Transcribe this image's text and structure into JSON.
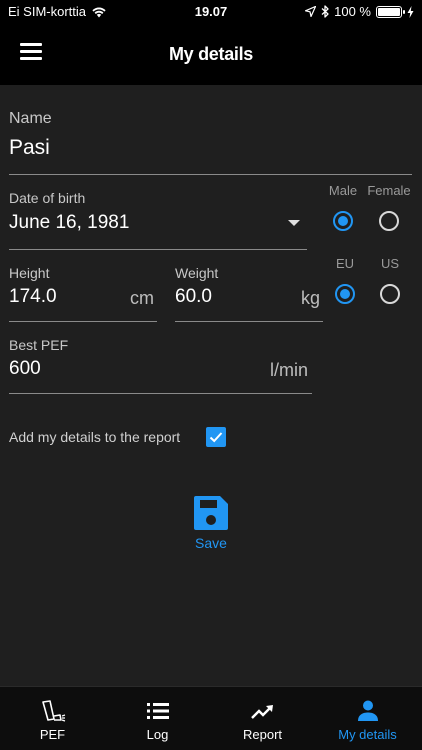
{
  "status_bar": {
    "carrier": "Ei SIM-korttia",
    "time": "19.07",
    "battery": "100 %",
    "battery_level": 1.0
  },
  "app_bar": {
    "title": "My details",
    "menu_icon": "hamburger-menu-icon"
  },
  "form": {
    "name": {
      "label": "Name",
      "value": "Pasi"
    },
    "date_of_birth": {
      "label": "Date of birth",
      "value": "June 16, 1981"
    },
    "gender": {
      "options": [
        "Male",
        "Female"
      ],
      "selected": "Male"
    },
    "height": {
      "label": "Height",
      "value": "174.0",
      "unit": "cm"
    },
    "weight": {
      "label": "Weight",
      "value": "60.0",
      "unit": "kg"
    },
    "units": {
      "options": [
        "EU",
        "US"
      ],
      "selected": "EU"
    },
    "best_pef": {
      "label": "Best PEF",
      "value": "600",
      "unit": "l/min"
    },
    "add_to_report": {
      "label": "Add my details to the report",
      "checked": true
    }
  },
  "save": {
    "label": "Save",
    "icon": "floppy-disk-icon"
  },
  "bottom_nav": {
    "items": [
      {
        "label": "PEF",
        "icon": "pef-meter-icon",
        "active": false
      },
      {
        "label": "Log",
        "icon": "list-icon",
        "active": false
      },
      {
        "label": "Report",
        "icon": "trending-up-icon",
        "active": false
      },
      {
        "label": "My details",
        "icon": "person-icon",
        "active": true
      }
    ]
  },
  "colors": {
    "accent": "#2196f3",
    "background": "#1f1f1f",
    "bar": "#000000"
  }
}
